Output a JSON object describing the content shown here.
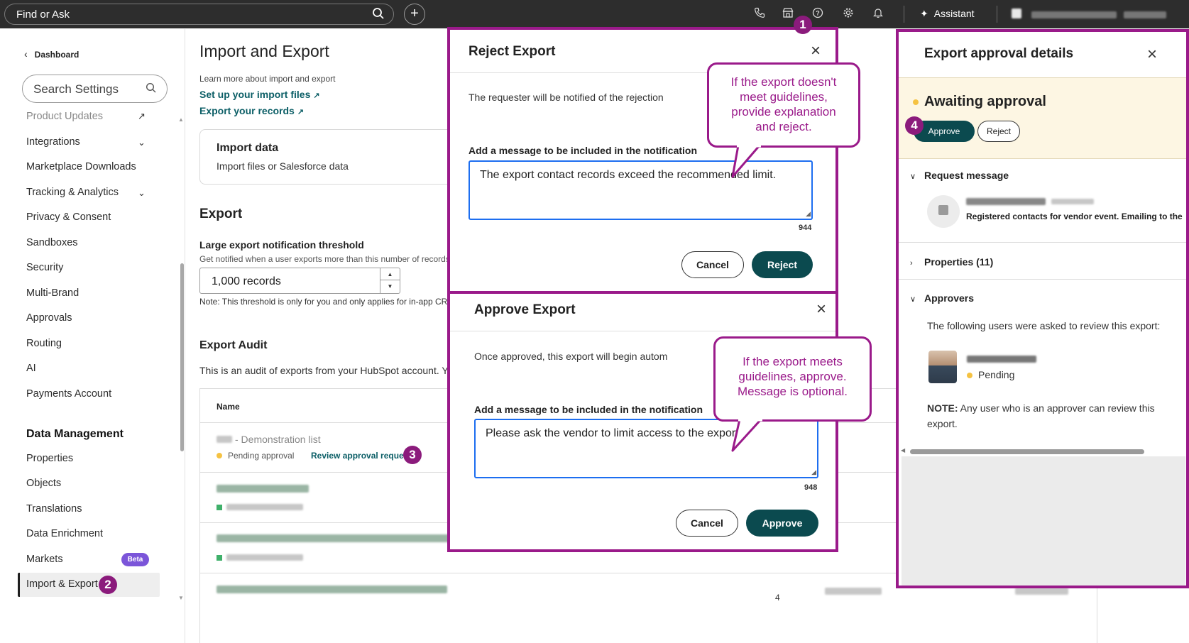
{
  "topbar": {
    "search_label": "Find or Ask",
    "assistant_label": "Assistant",
    "icons": [
      "search-icon",
      "plus-icon",
      "phone-icon",
      "marketplace-icon",
      "help-icon",
      "settings-icon",
      "bell-icon",
      "sparkle-icon"
    ]
  },
  "sidebar": {
    "back_label": "Dashboard",
    "search_placeholder": "Search Settings",
    "items": [
      {
        "label": "Product Updates"
      },
      {
        "label": "Integrations"
      },
      {
        "label": "Marketplace Downloads"
      },
      {
        "label": "Tracking & Analytics"
      },
      {
        "label": "Privacy & Consent"
      },
      {
        "label": "Sandboxes"
      },
      {
        "label": "Security"
      },
      {
        "label": "Multi-Brand"
      },
      {
        "label": "Approvals"
      },
      {
        "label": "Routing"
      },
      {
        "label": "AI"
      },
      {
        "label": "Payments Account"
      }
    ],
    "section_heading": "Data Management",
    "data_items": [
      {
        "label": "Properties"
      },
      {
        "label": "Objects"
      },
      {
        "label": "Translations"
      },
      {
        "label": "Data Enrichment"
      },
      {
        "label": "Markets"
      },
      {
        "label": "Import & Export"
      }
    ],
    "beta_label": "Beta"
  },
  "main": {
    "title": "Import and Export",
    "learn_more": "Learn more about import and export",
    "link_import": "Set up your import files",
    "link_export": "Export your records",
    "import_card": {
      "title": "Import data",
      "subtitle": "Import files or Salesforce data"
    },
    "export_heading": "Export",
    "threshold_label": "Large export notification threshold",
    "threshold_help": "Get notified when a user exports more than this number of records",
    "threshold_value": "1,000 records",
    "threshold_note": "Note: This threshold is only for you and only applies for in-app CRM",
    "audit_heading": "Export Audit",
    "audit_desc": "This is an audit of exports from your HubSpot account. You",
    "table": {
      "col_name": "Name",
      "row1_title": "- Demonstration list",
      "row1_status": "Pending approval",
      "row1_link": "Review approval request",
      "bottom_count": "4"
    }
  },
  "reject_modal": {
    "title": "Reject Export",
    "desc": "The requester will be notified of the rejection",
    "label": "Add a message to be included in the notification",
    "message": "The export contact records exceed the recommended limit.",
    "char_count": "944",
    "cancel": "Cancel",
    "confirm": "Reject"
  },
  "approve_modal": {
    "title": "Approve Export",
    "desc": "Once approved, this export will begin autom",
    "label": "Add a message to be included in the notification",
    "message": "Please ask the vendor to limit access to the export.",
    "char_count": "948",
    "cancel": "Cancel",
    "confirm": "Approve"
  },
  "callouts": {
    "reject": "If the export doesn't meet guidelines, provide explanation and reject.",
    "approve": "If the export meets guidelines, approve. Message is optional."
  },
  "badges": [
    "1",
    "2",
    "3",
    "4"
  ],
  "details_panel": {
    "title": "Export approval details",
    "status": "Awaiting approval",
    "approve": "Approve",
    "reject": "Reject",
    "request_message": "Request message",
    "request_text": "Registered contacts for vendor event. Emailing to the",
    "properties": "Properties (11)",
    "approvers": "Approvers",
    "approvers_desc": "The following users were asked to review this export:",
    "approver_status": "Pending",
    "note_bold": "NOTE:",
    "note_text": " Any user who is an approver can review this export."
  },
  "colors": {
    "topbar": "#2d2d2d",
    "accent_dark_teal": "#0b4a4f",
    "link_teal": "#0b5e66",
    "annotation_magenta": "#9a1a8a",
    "pending_yellow": "#f5c242",
    "beta_purple": "#7b55d9",
    "focus_blue": "#1d6ef0"
  }
}
